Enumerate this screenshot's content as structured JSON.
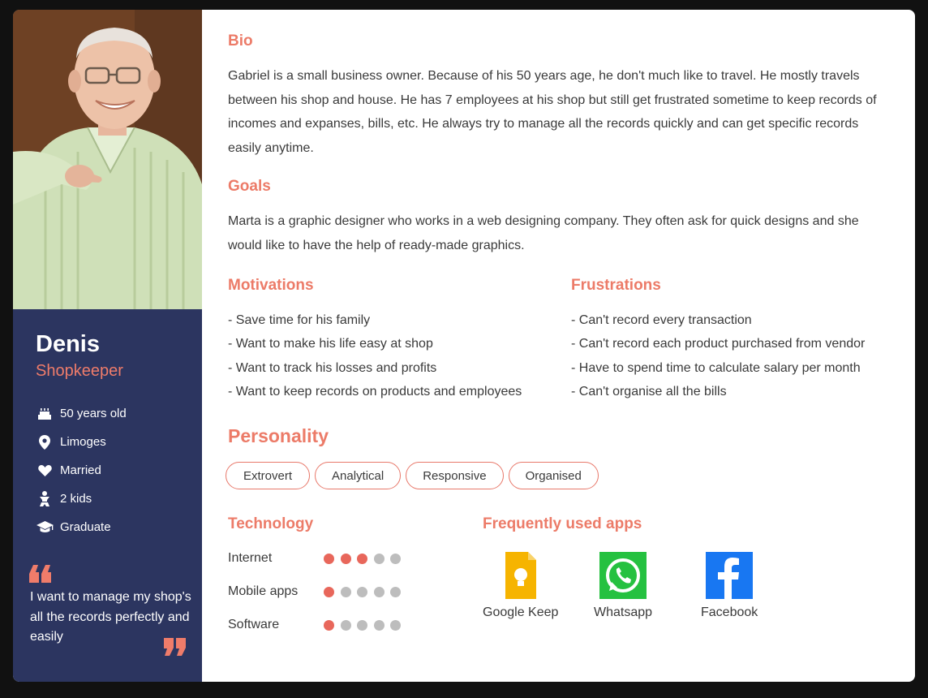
{
  "persona": {
    "name": "Denis",
    "role": "Shopkeeper",
    "facts": [
      {
        "icon": "cake-icon",
        "text": "50 years old"
      },
      {
        "icon": "location-pin-icon",
        "text": "Limoges"
      },
      {
        "icon": "heart-icon",
        "text": "Married"
      },
      {
        "icon": "kids-icon",
        "text": "2 kids"
      },
      {
        "icon": "graduation-cap-icon",
        "text": "Graduate"
      }
    ],
    "quote": "I want to manage my shop's all the records perfectly and easily"
  },
  "bio": {
    "title": "Bio",
    "text": "Gabriel is a small business owner. Because of his 50 years age, he don't much like to travel. He mostly travels between his shop and house. He has 7 employees at his shop but still get frustrated sometime to keep records of incomes and expanses, bills, etc. He always try to manage all the records quickly and can get specific records easily anytime."
  },
  "goals": {
    "title": "Goals",
    "text": "Marta is a graphic designer who works in a web designing company. They often ask for quick designs and she would like to have the help of ready-made graphics."
  },
  "motivations": {
    "title": "Motivations",
    "items": [
      "- Save time for his family",
      "- Want to make his life easy at shop",
      "- Want to track his losses and profits",
      "- Want to keep records on products and employees"
    ]
  },
  "frustrations": {
    "title": "Frustrations",
    "items": [
      "- Can't record every transaction",
      "- Can't record each product purchased from vendor",
      "- Have to spend time to calculate salary per month",
      "- Can't organise all the bills"
    ]
  },
  "personality": {
    "title": "Personality",
    "tags": [
      "Extrovert",
      "Analytical",
      "Responsive",
      "Organised"
    ]
  },
  "technology": {
    "title": "Technology",
    "max_level": 5,
    "items": [
      {
        "label": "Internet",
        "level": 3
      },
      {
        "label": "Mobile apps",
        "level": 1
      },
      {
        "label": "Software",
        "level": 1
      }
    ]
  },
  "apps": {
    "title": "Frequently used apps",
    "items": [
      {
        "label": "Google Keep",
        "icon": "google-keep-icon",
        "color": "#f6b400"
      },
      {
        "label": "Whatsapp",
        "icon": "whatsapp-icon",
        "color": "#25c140"
      },
      {
        "label": "Facebook",
        "icon": "facebook-icon",
        "color": "#1877f2"
      }
    ]
  },
  "colors": {
    "accent": "#ec7b68",
    "sidebar": "#2c3560",
    "dot_on": "#e8675b",
    "dot_off": "#bdbdbd"
  }
}
